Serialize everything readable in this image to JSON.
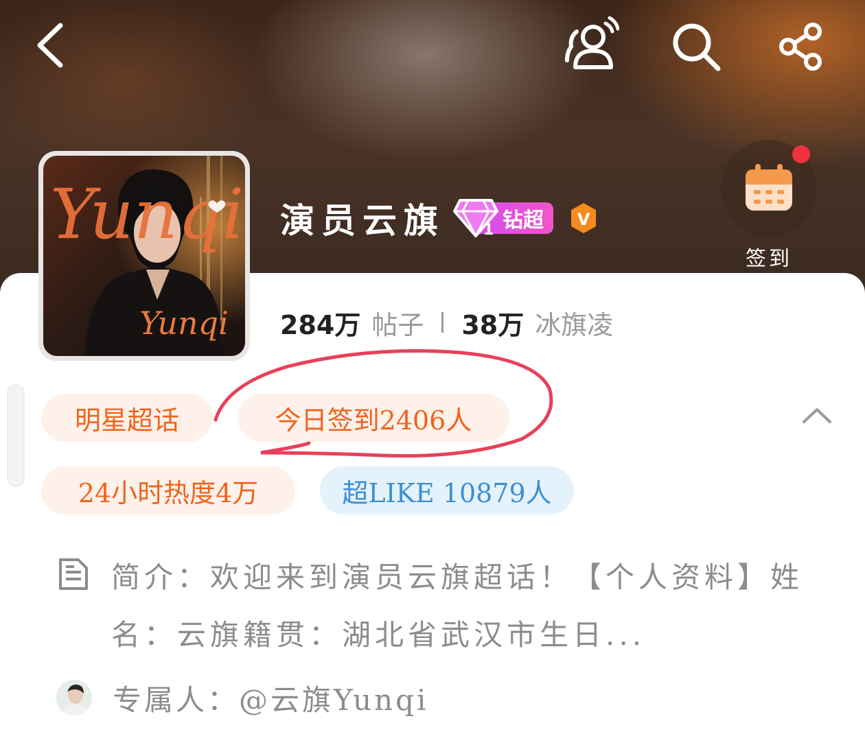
{
  "header": {
    "back_icon": "chevron-left-icon",
    "topic_people_icon": "people-topic-icon",
    "search_icon": "search-icon",
    "share_icon": "share-icon"
  },
  "topic": {
    "title": "演员云旗",
    "badge_level": "1",
    "badge_label": "钻超",
    "verified_letter": "V",
    "avatar_text_top": "Yunqi",
    "avatar_text_bottom": "Yunqi"
  },
  "checkin": {
    "label": "签到",
    "icon": "calendar-icon"
  },
  "stats": {
    "posts_value": "284万",
    "posts_label": "帖子",
    "fans_value": "38万",
    "fans_label": "冰旗凌"
  },
  "tags": {
    "star_topic": "明星超话",
    "today_checkin": "今日签到2406人",
    "heat_24h": "24小时热度4万",
    "super_like": "超LIKE 10879人"
  },
  "intro": {
    "text": "简介：欢迎来到演员云旗超话！【个人资料】姓名：云旗籍贯：湖北省武汉市生日..."
  },
  "owner": {
    "text": "专属人：@云旗Yunqi"
  },
  "colors": {
    "accent_orange": "#f0631c",
    "tag_orange_bg": "#fdf1ea",
    "tag_blue": "#3f8ed0",
    "tag_blue_bg": "#e3f2fb",
    "highlight_red": "#e8405a",
    "badge_pink": "#e050e0",
    "verified_orange": "#f58a1e"
  }
}
